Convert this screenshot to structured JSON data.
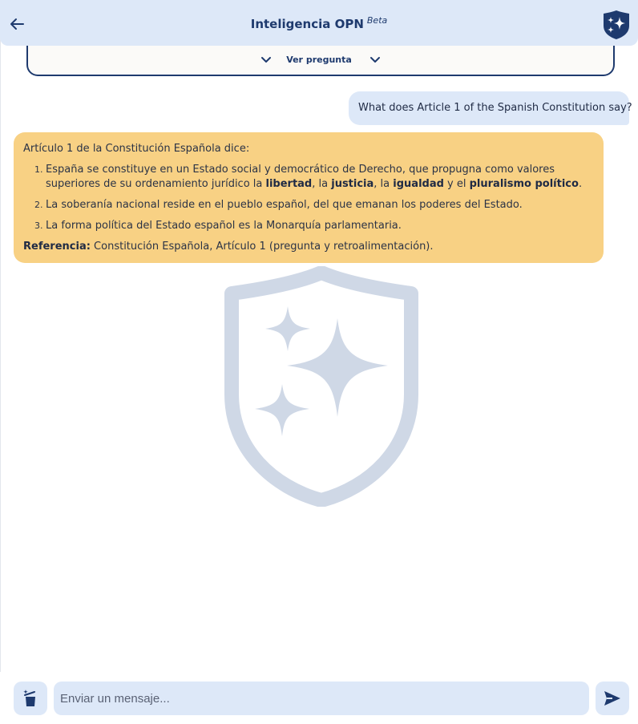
{
  "header": {
    "title": "Inteligencia OPN",
    "badge": "Beta",
    "back_icon": "arrow-left-icon",
    "logo_icon": "shield-sparkles-logo"
  },
  "question_panel": {
    "toggle_label": "Ver pregunta"
  },
  "conversation": {
    "user_message": "What does Article 1 of the Spanish Constitution say?",
    "answer": {
      "intro": "Artículo 1 de la Constitución Española dice:",
      "items": [
        {
          "before": "España se constituye en un Estado social y democrático de Derecho, que propugna como valores superiores de su ordenamiento jurídico la ",
          "v1": "libertad",
          "s1": ", la ",
          "v2": "justicia",
          "s2": ", la ",
          "v3": "igualdad",
          "s3": " y el ",
          "v4": "pluralismo político",
          "end": "."
        },
        {
          "text": "La soberanía nacional reside en el pueblo español, del que emanan los poderes del Estado."
        },
        {
          "text": "La forma política del Estado español es la Monarquía parlamentaria."
        }
      ],
      "reference_label": "Referencia:",
      "reference_text": " Constitución Española, Artículo 1 (pregunta y retroalimentación)."
    }
  },
  "footer": {
    "input_placeholder": "Enviar un mensaje...",
    "input_value": "",
    "clear_icon": "trash-sparkle-icon",
    "send_icon": "send-icon"
  },
  "colors": {
    "header_bg": "#dde8f8",
    "brand_navy": "#1e3a6e",
    "answer_bg": "#f8d184",
    "watermark": "#cfd8e6"
  }
}
